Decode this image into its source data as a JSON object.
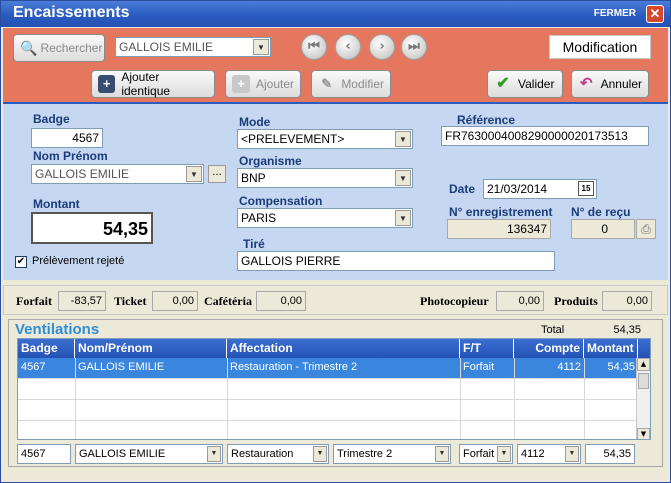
{
  "window": {
    "title": "Encaissements",
    "close_label": "FERMER",
    "close_glyph": "✕"
  },
  "toolbar": {
    "search_label": "Rechercher",
    "search_value": "GALLOIS EMILIE",
    "mode_label": "Modification",
    "ajouter_identique": "Ajouter identique",
    "ajouter": "Ajouter",
    "modifier": "Modifier",
    "valider": "Valider",
    "annuler": "Annuler",
    "nav": {
      "first": "⏮",
      "prev": "‹",
      "next": "›",
      "last": "⏭"
    }
  },
  "form": {
    "badge_label": "Badge",
    "badge_value": "4567",
    "nom_label": "Nom Prénom",
    "nom_value": "GALLOIS EMILIE",
    "montant_label": "Montant",
    "montant_value": "54,35",
    "rejete_label": "Prélèvement rejeté",
    "rejete_checked": "✔",
    "mode_label": "Mode",
    "mode_value": "<PRELEVEMENT>",
    "organisme_label": "Organisme",
    "organisme_value": "BNP",
    "compensation_label": "Compensation",
    "compensation_value": "PARIS",
    "tire_label": "Tiré",
    "tire_value": "GALLOIS PIERRE",
    "reference_label": "Référence",
    "reference_value": "FR7630004008290000020173513",
    "date_label": "Date",
    "date_value": "21/03/2014",
    "date_icon_text": "15",
    "enregistrement_label": "N° enregistrement",
    "enregistrement_value": "136347",
    "recu_label": "N° de reçu",
    "recu_value": "0",
    "ellipsis": "..."
  },
  "totals": {
    "forfait_label": "Forfait",
    "forfait_value": "-83,57",
    "ticket_label": "Ticket",
    "ticket_value": "0,00",
    "cafeteria_label": "Cafétéria",
    "cafeteria_value": "0,00",
    "photocopieur_label": "Photocopieur",
    "photocopieur_value": "0,00",
    "produits_label": "Produits",
    "produits_value": "0,00"
  },
  "ventilations": {
    "title": "Ventilations",
    "total_label": "Total",
    "total_value": "54,35",
    "columns": [
      "Badge",
      "Nom/Prénom",
      "Affectation",
      "F/T",
      "Compte",
      "Montant"
    ],
    "rows": [
      {
        "badge": "4567",
        "nom": "GALLOIS EMILIE",
        "affectation": "Restauration - Trimestre 2",
        "ft": "Forfait",
        "compte": "4112",
        "montant": "54,35"
      }
    ],
    "edit": {
      "badge": "4567",
      "nom": "GALLOIS EMILIE",
      "affectation": "Restauration",
      "periode": "Trimestre 2",
      "ft": "Forfait",
      "compte": "4112",
      "montant": "54,35"
    }
  },
  "colors": {
    "toolbar": "#e5775f",
    "form": "#c6d8f1",
    "title": "#2a5bc0",
    "accent": "#2f8ed6"
  }
}
